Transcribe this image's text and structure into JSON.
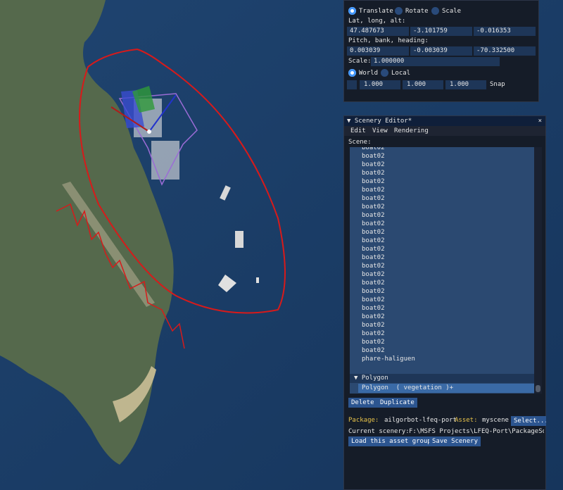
{
  "transform_panel": {
    "modes": [
      "Translate",
      "Rotate",
      "Scale"
    ],
    "lat_long_alt_label": "Lat, long, alt:",
    "lat": "47.487673",
    "long": "-3.101759",
    "alt": "-0.016353",
    "pbh_label": "Pitch, bank, heading:",
    "pitch": "0.003039",
    "bank": "-0.003039",
    "heading": "-70.332500",
    "scale_label": "Scale:",
    "scale": "1.000000",
    "spaces": [
      "World",
      "Local"
    ],
    "snap_values": [
      "1.000",
      "1.000",
      "1.000"
    ],
    "snap_label": "Snap"
  },
  "editor": {
    "title": "▼ Scenery Editor*",
    "close": "×",
    "menu": [
      "Edit",
      "View",
      "Rendering"
    ],
    "scene_label": "Scene:",
    "items": [
      "boat02",
      "boat02",
      "boat02",
      "boat02",
      "boat02",
      "boat02",
      "boat02",
      "boat02",
      "boat02",
      "boat02",
      "boat02",
      "boat02",
      "boat02",
      "boat02",
      "boat02",
      "boat02",
      "boat02",
      "boat02",
      "boat02",
      "boat02",
      "boat02",
      "boat02",
      "boat02",
      "boat02",
      "boat02",
      "phare-haliguen"
    ],
    "group_label": "▼  Polygon",
    "selected_item": "Polygon  ( vegetation )+",
    "delete_label": "Delete",
    "duplicate_label": "Duplicate",
    "package_label": "Package:",
    "package_value": "ailgorbot-lfeq-port",
    "asset_label": "Asset:",
    "asset_value": "myscene",
    "select_label": "Select...",
    "current_scenery_label": "Current scenery:",
    "current_scenery_path": "F:\\MSFS Projects\\LFEQ-Port\\PackageSources\\",
    "load_label": "Load this asset group",
    "save_label": "Save Scenery"
  },
  "colors": {
    "water": "#1d3f66",
    "land": "#5b6e52",
    "accent": "#4296fa",
    "annotation": "#d81a1a",
    "label_yellow": "#e8c34a"
  }
}
